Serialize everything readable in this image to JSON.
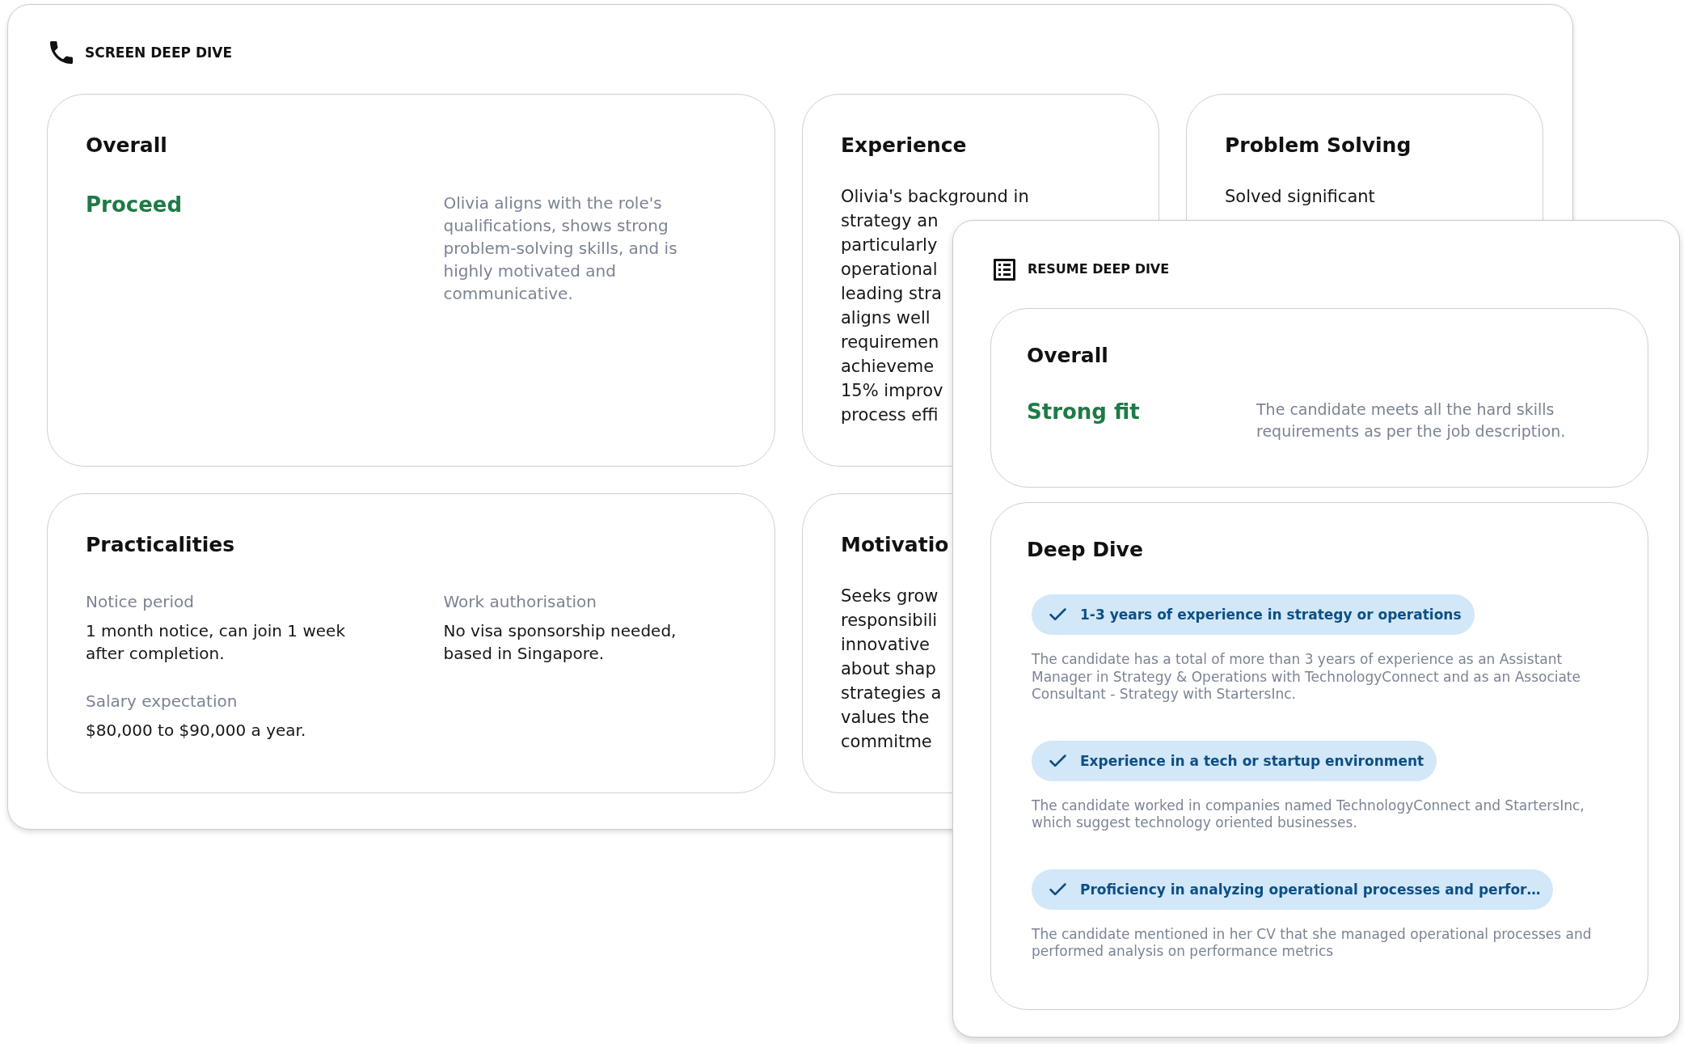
{
  "screen_deep_dive": {
    "title": "SCREEN DEEP DIVE",
    "cards": [
      {
        "kind": "verdict",
        "title": "Overall",
        "verdict": "Proceed",
        "summary": "Olivia aligns with the role's qualifications, shows strong problem-solving skills, and is highly motivated and communicative."
      },
      {
        "kind": "notes",
        "title": "Experience",
        "lines": [
          "Olivia's background in",
          "strategy an",
          "particularly",
          "operational",
          "leading stra",
          "aligns well",
          "requiremen",
          "achieveme",
          "15% improv",
          "process effi"
        ]
      },
      {
        "kind": "notes",
        "title": "Problem Solving",
        "lines": [
          "Solved significant"
        ]
      },
      {
        "kind": "fields",
        "title": "Practicalities",
        "fields": [
          {
            "label": "Notice period",
            "value": "1 month notice, can join 1 week after completion."
          },
          {
            "label": "Work authorisation",
            "value": "No visa sponsorship needed, based in Singapore."
          },
          {
            "label": "Salary expectation",
            "value": "$80,000 to $90,000 a year."
          }
        ]
      },
      {
        "kind": "notes",
        "title": "Motivatio",
        "lines": [
          "Seeks grow",
          "responsibili",
          "innovative",
          "about shap",
          "strategies a",
          "values the",
          "commitme"
        ]
      }
    ]
  },
  "resume_deep_dive": {
    "title": "RESUME DEEP DIVE",
    "overall": {
      "title": "Overall",
      "verdict": "Strong fit",
      "summary": "The candidate meets all the hard skills requirements as per the job description."
    },
    "deep_dive": {
      "title": "Deep Dive",
      "criteria": [
        {
          "label": "1-3 years of experience in strategy or operations",
          "met": true,
          "explanation": "The candidate has a total of more than 3 years of experience as an Assistant Manager in Strategy & Operations with TechnologyConnect and as an Associate Consultant - Strategy with StartersInc."
        },
        {
          "label": "Experience in a tech or startup environment",
          "met": true,
          "explanation": "The candidate worked in companies named TechnologyConnect and StartersInc, which suggest technology oriented businesses."
        },
        {
          "label": "Proficiency in analyzing operational processes and perfor…",
          "met": true,
          "explanation": "The candidate mentioned in her CV that she managed operational processes and performed analysis on performance metrics"
        }
      ]
    }
  }
}
